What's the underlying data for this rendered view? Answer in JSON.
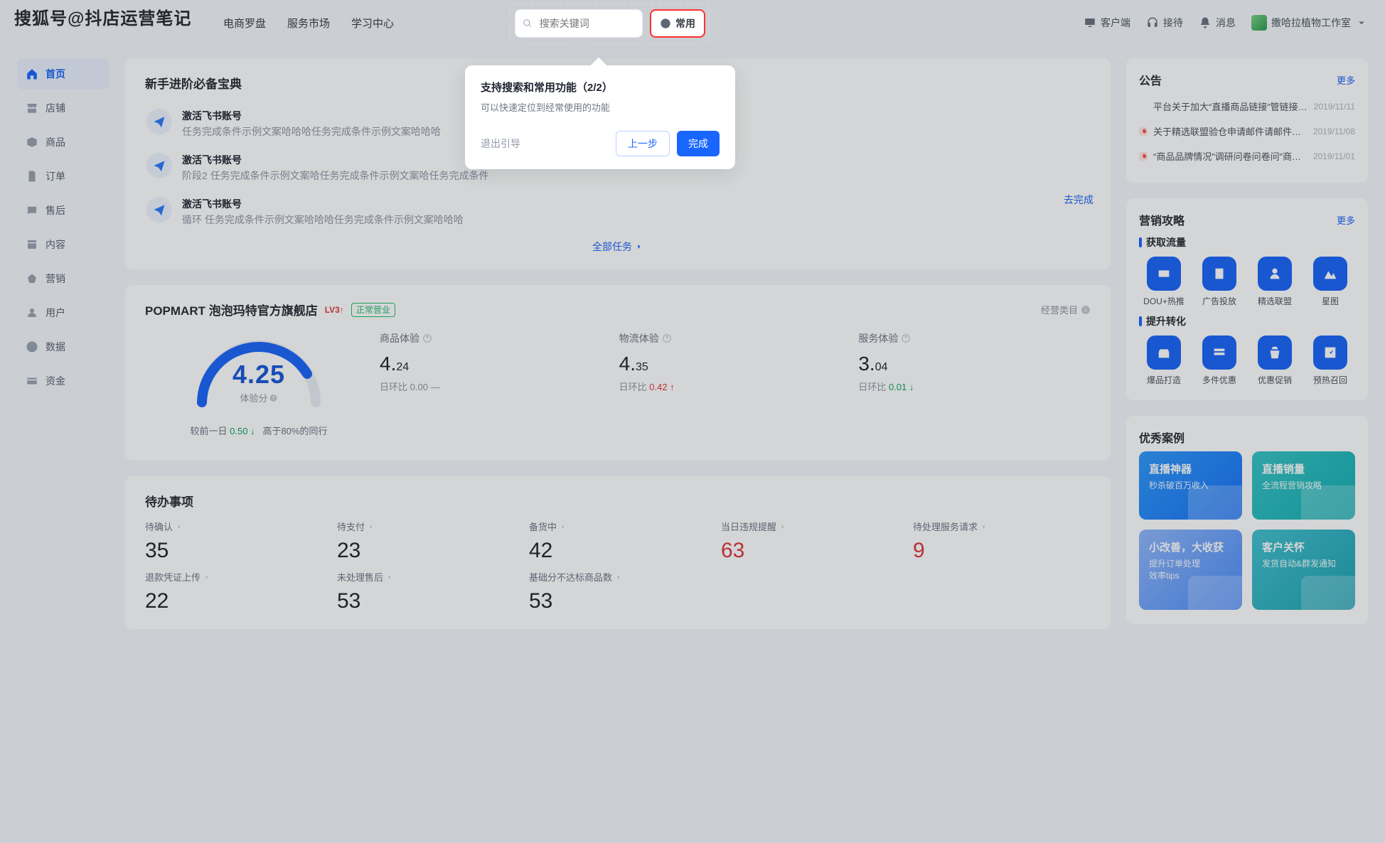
{
  "watermark": "搜狐号@抖店运营笔记",
  "header": {
    "nav": [
      "电商罗盘",
      "服务市场",
      "学习中心"
    ],
    "search_placeholder": "搜索关键词",
    "freq_label": "常用",
    "right": {
      "client": "客户端",
      "service": "接待",
      "msg": "消息",
      "shop": "撒哈拉植物工作室"
    }
  },
  "tour": {
    "title": "支持搜索和常用功能（2/2）",
    "desc": "可以快速定位到经常使用的功能",
    "exit": "退出引导",
    "prev": "上一步",
    "done": "完成"
  },
  "sidebar": {
    "items": [
      {
        "label": "首页",
        "icon": "home"
      },
      {
        "label": "店铺",
        "icon": "store"
      },
      {
        "label": "商品",
        "icon": "box"
      },
      {
        "label": "订单",
        "icon": "order"
      },
      {
        "label": "售后",
        "icon": "after"
      },
      {
        "label": "内容",
        "icon": "content"
      },
      {
        "label": "营销",
        "icon": "market"
      },
      {
        "label": "用户",
        "icon": "user"
      },
      {
        "label": "数据",
        "icon": "data"
      },
      {
        "label": "资金",
        "icon": "fund"
      }
    ],
    "active_index": 0
  },
  "newbie": {
    "title": "新手进阶必备宝典",
    "tasks": [
      {
        "title": "激活飞书账号",
        "desc": "任务完成条件示例文案哈哈哈任务完成条件示例文案哈哈哈"
      },
      {
        "title": "激活飞书账号",
        "prefix": "阶段2",
        "desc": "任务完成条件示例文案哈任务完成条件示例文案哈任务完成条件"
      },
      {
        "title": "激活飞书账号",
        "prefix": "循环",
        "desc": "任务完成条件示例文案哈哈哈任务完成条件示例文案哈哈哈"
      }
    ],
    "go": "去完成",
    "all": "全部任务"
  },
  "shop": {
    "name": "POPMART 泡泡玛特官方旗舰店",
    "level": "LV3",
    "status": "正常营业",
    "category_label": "经营类目",
    "score": {
      "value": "4.25",
      "caption": "体验分",
      "footer_prefix": "较前一日",
      "footer_delta": "0.50",
      "footer_suffix": "高于80%的同行"
    },
    "metrics": [
      {
        "label": "商品体验",
        "value": "4.24",
        "dd_label": "日环比",
        "delta": "0.00",
        "dir": "flat"
      },
      {
        "label": "物流体验",
        "value": "4.35",
        "dd_label": "日环比",
        "delta": "0.42",
        "dir": "up"
      },
      {
        "label": "服务体验",
        "value": "3.04",
        "dd_label": "日环比",
        "delta": "0.01",
        "dir": "down"
      }
    ]
  },
  "todos": {
    "title": "待办事项",
    "items": [
      {
        "label": "待确认",
        "value": "35"
      },
      {
        "label": "待支付",
        "value": "23"
      },
      {
        "label": "备货中",
        "value": "42"
      },
      {
        "label": "当日违规提醒",
        "value": "63",
        "red": true
      },
      {
        "label": "待处理服务请求",
        "value": "9",
        "red": true
      },
      {
        "label": "退款凭证上传",
        "value": "22"
      },
      {
        "label": "未处理售后",
        "value": "53"
      },
      {
        "label": "基础分不达标商品数",
        "value": "53"
      }
    ]
  },
  "announce": {
    "title": "公告",
    "more": "更多",
    "items": [
      {
        "hot": false,
        "text": "平台关于加大“直播商品链接”管链接”管理…",
        "date": "2019/11/11"
      },
      {
        "hot": true,
        "text": "关于精选联盟验仓申请邮件请邮件请邮…",
        "date": "2019/11/08"
      },
      {
        "hot": true,
        "text": "“商品品牌情况”调研问卷问卷问”商品…",
        "date": "2019/11/01"
      }
    ]
  },
  "strategy": {
    "title": "营销攻略",
    "more": "更多",
    "section1_title": "获取流量",
    "section1": [
      {
        "name": "DOU+热推"
      },
      {
        "name": "广告投放"
      },
      {
        "name": "精选联盟"
      },
      {
        "name": "星图"
      }
    ],
    "section2_title": "提升转化",
    "section2": [
      {
        "name": "爆品打造"
      },
      {
        "name": "多件优惠"
      },
      {
        "name": "优惠促销"
      },
      {
        "name": "预热召回"
      }
    ]
  },
  "cases": {
    "title": "优秀案例",
    "items": [
      {
        "title": "直播神器",
        "desc": "秒杀破百万收入"
      },
      {
        "title": "直播销量",
        "desc": "全流程营销攻略"
      },
      {
        "title": "小改善，大收获",
        "desc": "提升订单处理\n效率tips"
      },
      {
        "title": "客户关怀",
        "desc": "发货自动&群发通知"
      }
    ]
  }
}
